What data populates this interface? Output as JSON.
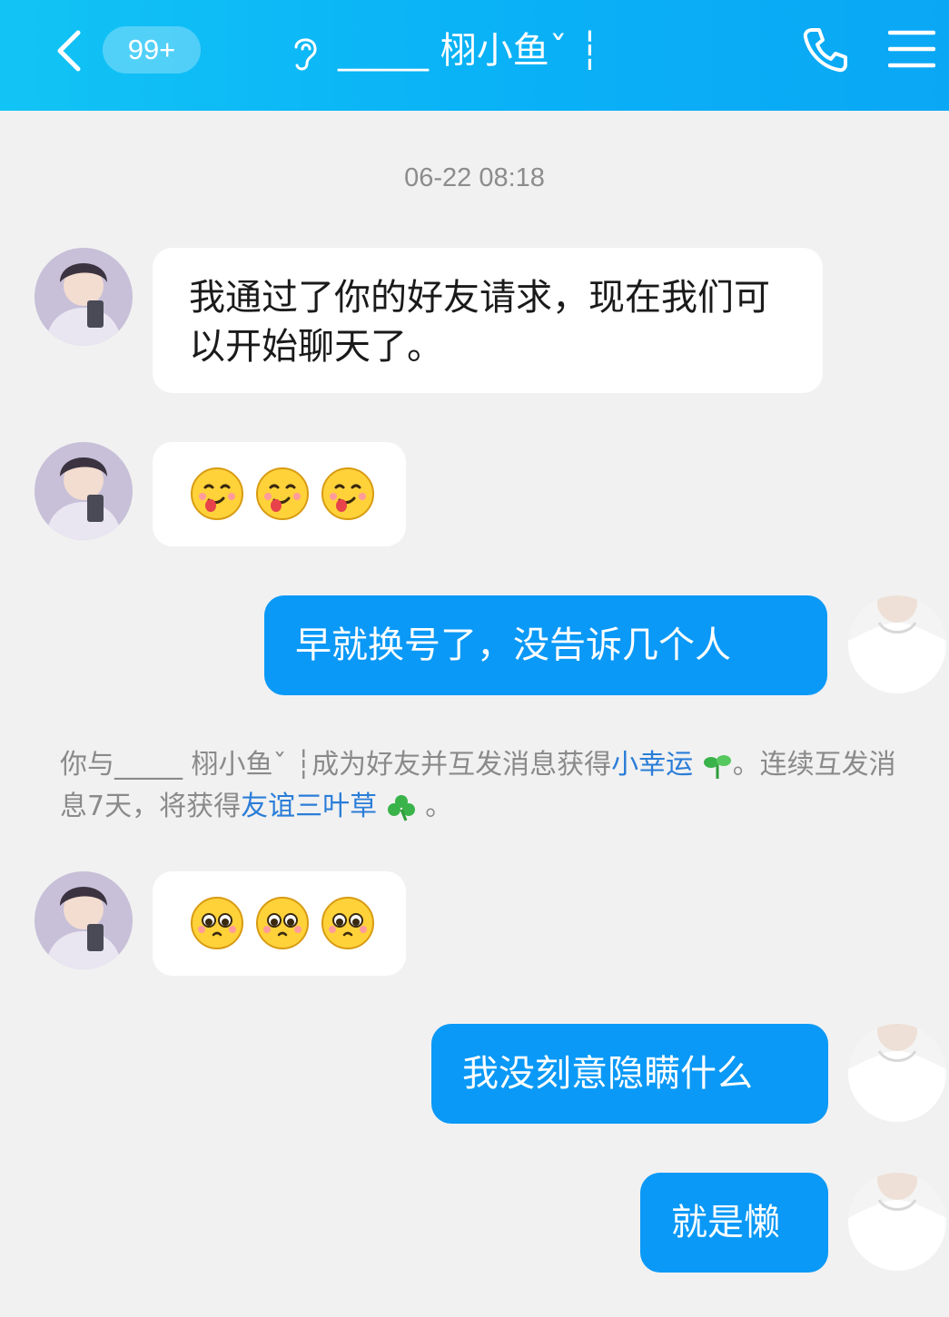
{
  "header": {
    "unread_badge": "99+",
    "contact_name": "_____ 栩小鱼ˇ ┆"
  },
  "timestamp": "06-22 08:18",
  "messages": [
    {
      "side": "in",
      "type": "text",
      "text": "我通过了你的好友请求，现在我们可以开始聊天了。"
    },
    {
      "side": "in",
      "type": "emoji",
      "emoji": [
        "tongue-face-emoji",
        "tongue-face-emoji",
        "tongue-face-emoji"
      ]
    },
    {
      "side": "out",
      "type": "text",
      "text": "早就换号了，没告诉几个人"
    },
    {
      "side": "in",
      "type": "emoji",
      "emoji": [
        "pleading-face-emoji",
        "pleading-face-emoji",
        "pleading-face-emoji"
      ]
    },
    {
      "side": "out",
      "type": "text",
      "text": "我没刻意隐瞒什么"
    },
    {
      "side": "out",
      "type": "text",
      "text": "就是懒"
    }
  ],
  "system_notice": {
    "prefix": "你与_____ 栩小鱼ˇ ┆成为好友并互发消息获得",
    "link1": "小幸运",
    "middle": "。连续互发消息7天，将获得",
    "link2": "友谊三叶草",
    "suffix": "。"
  },
  "colors": {
    "header": "#0ab2f6",
    "outgoing_bubble": "#0a99f7",
    "incoming_bubble": "#ffffff",
    "background": "#f1f1f1",
    "link": "#2a7dd8"
  },
  "icons": [
    "back-icon",
    "ear-icon",
    "phone-icon",
    "menu-icon",
    "sprout-icon",
    "clover-icon"
  ]
}
